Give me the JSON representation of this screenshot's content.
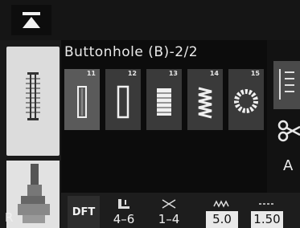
{
  "header": {
    "pattern_title": "Buttonhole (B)-2/2"
  },
  "left_panel": {
    "r_label": "R"
  },
  "patterns": [
    {
      "number": "11",
      "selected": true
    },
    {
      "number": "12",
      "selected": false
    },
    {
      "number": "13",
      "selected": false
    },
    {
      "number": "14",
      "selected": false
    },
    {
      "number": "15",
      "selected": false
    }
  ],
  "right_panel": {
    "a_label": "A"
  },
  "settings": {
    "dft_label": "DFT",
    "foot_range": "4–6",
    "tension_range": "1–4",
    "width_value": "5.0",
    "length_value": "1.50"
  },
  "colors": {
    "screen_bg": "#0c0c0c",
    "tile": "#3a3a3a",
    "tile_selected": "#5a5a5a"
  }
}
